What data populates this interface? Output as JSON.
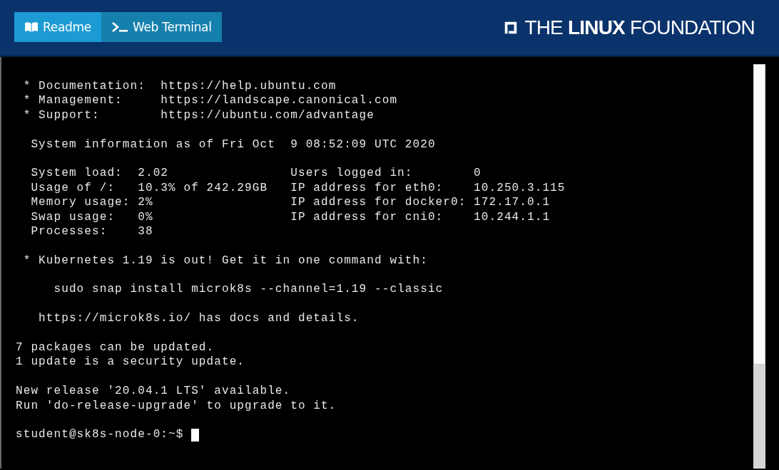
{
  "header": {
    "tabs": [
      {
        "label": "Readme",
        "selected": false
      },
      {
        "label": "Web Terminal",
        "selected": true
      }
    ],
    "logo": "THE **LINUX** FOUNDATION"
  },
  "terminal": {
    "blocks": [
      [
        " * Documentation:  https://help.ubuntu.com",
        " * Management:     https://landscape.canonical.com",
        " * Support:        https://ubuntu.com/advantage"
      ],
      [
        "  System information as of Fri Oct  9 08:52:09 UTC 2020"
      ],
      [
        "  System load:  2.02                Users logged in:        0",
        "  Usage of /:   10.3% of 242.29GB   IP address for eth0:    10.250.3.115",
        "  Memory usage: 2%                  IP address for docker0: 172.17.0.1",
        "  Swap usage:   0%                  IP address for cni0:    10.244.1.1",
        "  Processes:    38"
      ],
      [
        " * Kubernetes 1.19 is out! Get it in one command with:"
      ],
      [
        "     sudo snap install microk8s --channel=1.19 --classic"
      ],
      [
        "   https://microk8s.io/ has docs and details."
      ],
      [
        "7 packages can be updated.",
        "1 update is a security update."
      ],
      [
        "New release '20.04.1 LTS' available.",
        "Run 'do-release-upgrade' to upgrade to it."
      ]
    ],
    "prompt": "student@sk8s-node-0:~$ "
  }
}
